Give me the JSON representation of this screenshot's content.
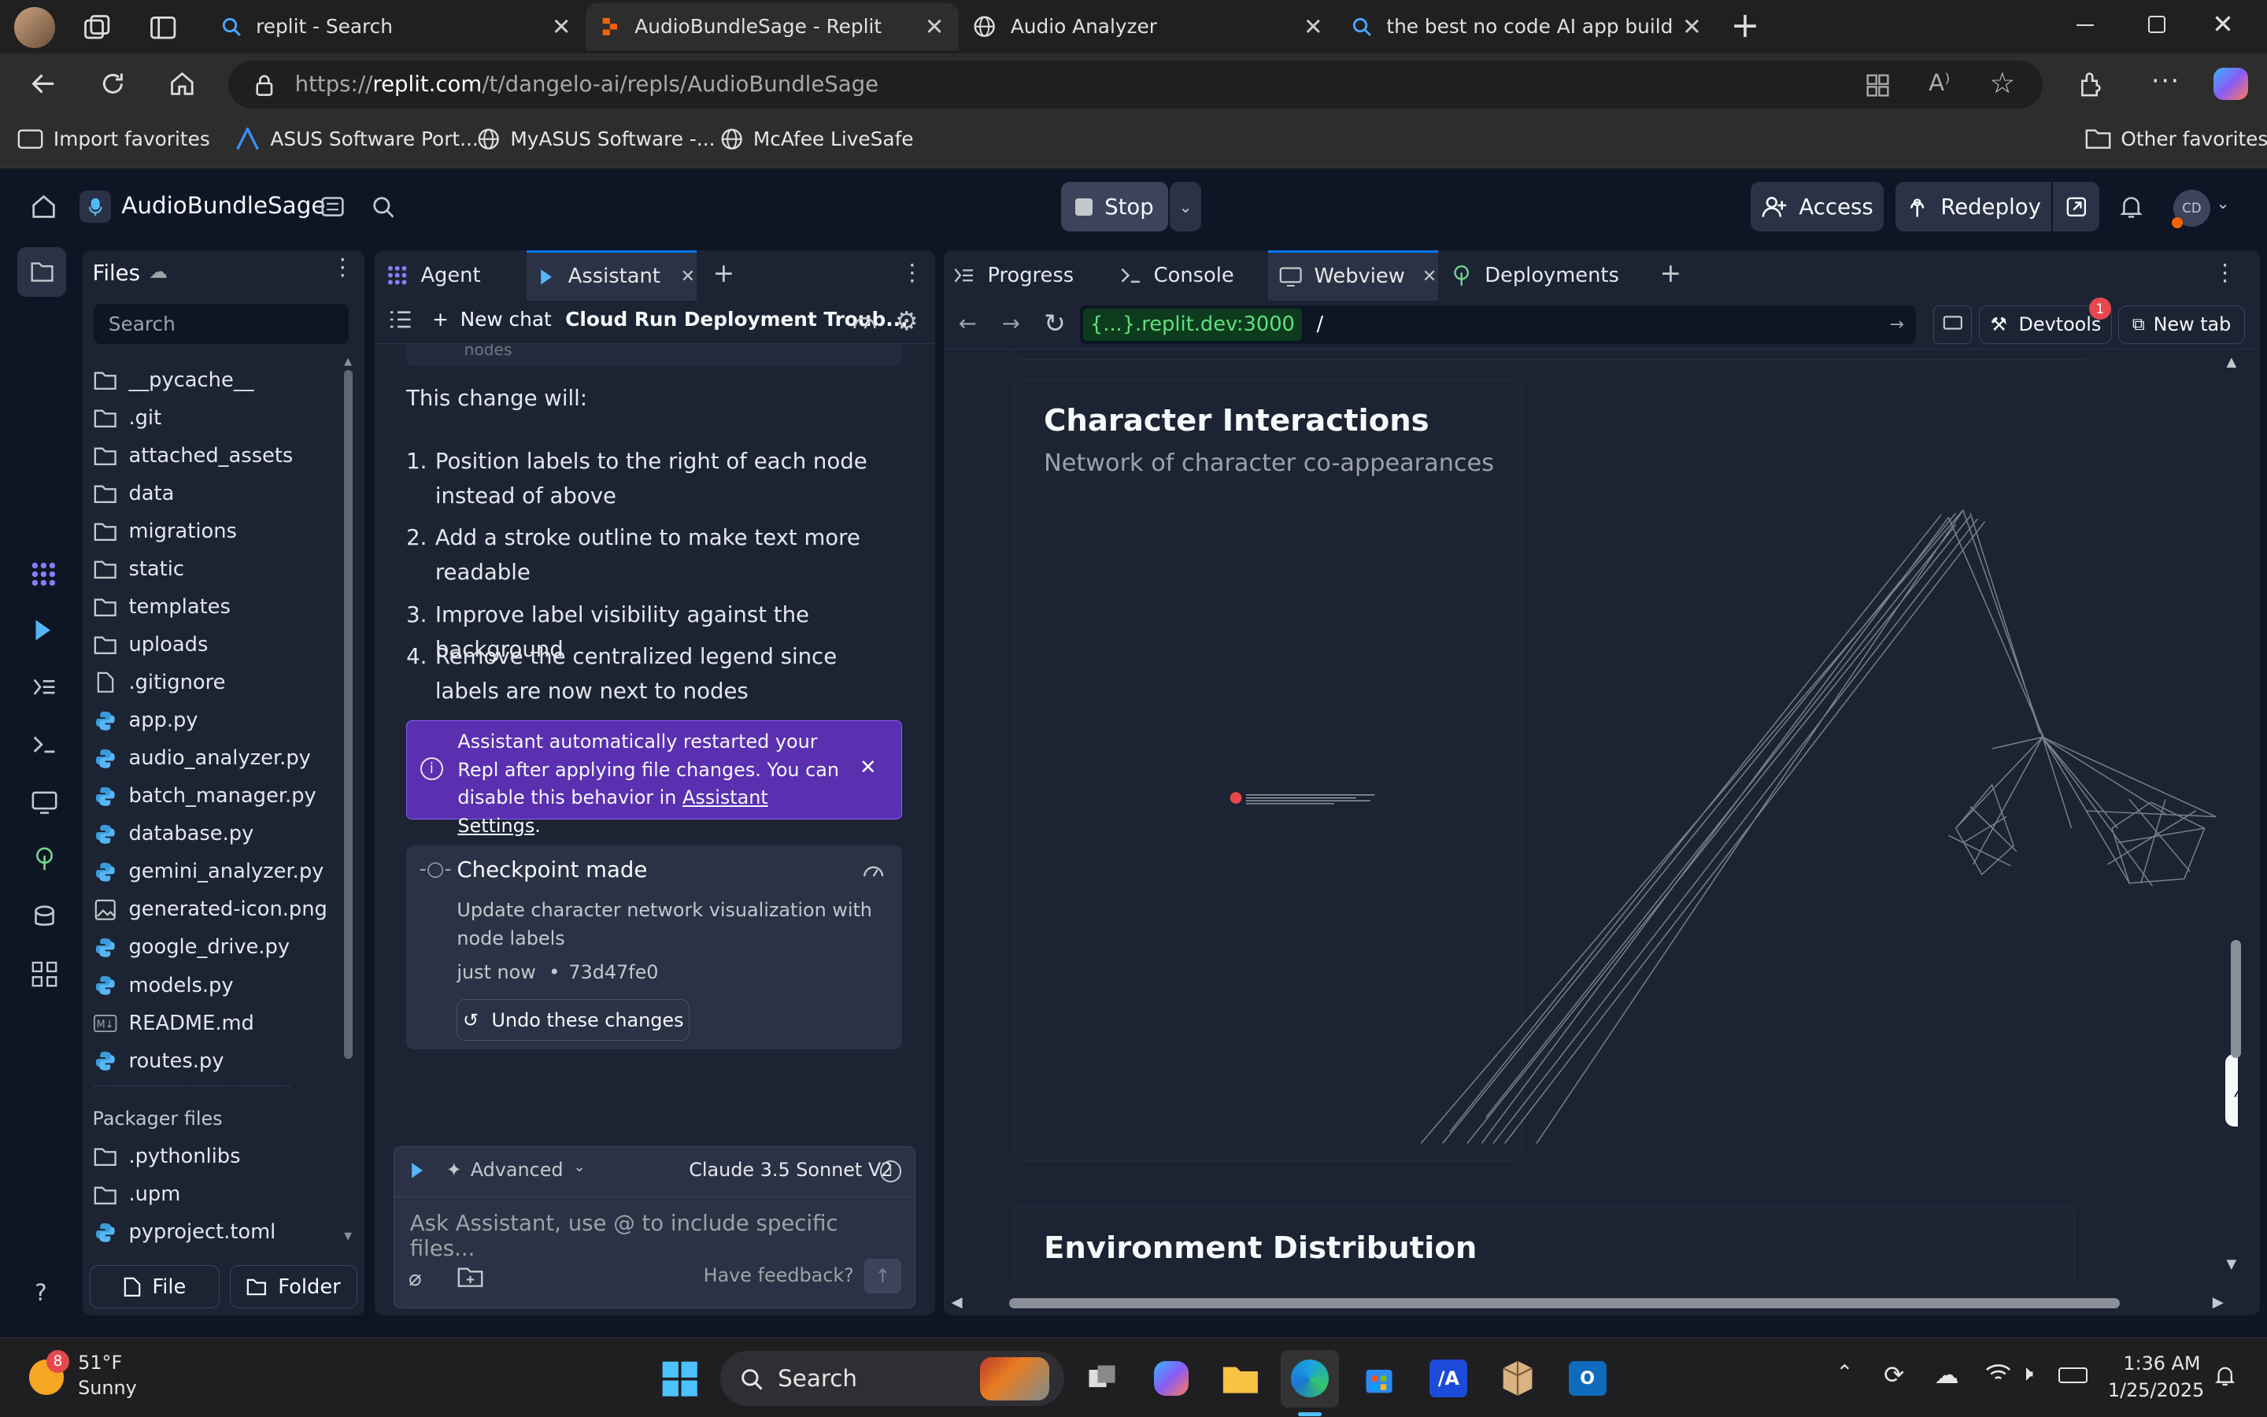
{
  "browser": {
    "tabs": [
      {
        "title": "replit - Search",
        "icon": "search-icon"
      },
      {
        "title": "AudioBundleSage - Replit",
        "icon": "replit-icon",
        "active": true
      },
      {
        "title": "Audio Analyzer",
        "icon": "globe-icon"
      },
      {
        "title": "the best no code AI app builder -",
        "icon": "search-icon"
      }
    ],
    "url_prefix": "https://",
    "url_host": "replit.com",
    "url_path": "/t/dangelo-ai/repls/AudioBundleSage",
    "favorites": [
      {
        "label": "Import favorites",
        "icon": "import-icon"
      },
      {
        "label": "ASUS Software Port...",
        "icon": "asus-icon"
      },
      {
        "label": "MyASUS Software -...",
        "icon": "globe-icon"
      },
      {
        "label": "McAfee LiveSafe",
        "icon": "globe-icon"
      }
    ],
    "other_favorites": "Other favorites"
  },
  "replit": {
    "project_name": "AudioBundleSage",
    "stop_label": "Stop",
    "access_label": "Access",
    "redeploy_label": "Redeploy",
    "avatar_initials": "CD",
    "files": {
      "title": "Files",
      "search_placeholder": "Search",
      "items": [
        {
          "name": "__pycache__",
          "type": "folder"
        },
        {
          "name": ".git",
          "type": "folder"
        },
        {
          "name": "attached_assets",
          "type": "folder"
        },
        {
          "name": "data",
          "type": "folder"
        },
        {
          "name": "migrations",
          "type": "folder"
        },
        {
          "name": "static",
          "type": "folder"
        },
        {
          "name": "templates",
          "type": "folder"
        },
        {
          "name": "uploads",
          "type": "folder"
        },
        {
          "name": ".gitignore",
          "type": "file"
        },
        {
          "name": "app.py",
          "type": "python"
        },
        {
          "name": "audio_analyzer.py",
          "type": "python"
        },
        {
          "name": "batch_manager.py",
          "type": "python"
        },
        {
          "name": "database.py",
          "type": "python"
        },
        {
          "name": "gemini_analyzer.py",
          "type": "python"
        },
        {
          "name": "generated-icon.png",
          "type": "image"
        },
        {
          "name": "google_drive.py",
          "type": "python"
        },
        {
          "name": "models.py",
          "type": "python"
        },
        {
          "name": "README.md",
          "type": "markdown"
        },
        {
          "name": "routes.py",
          "type": "python"
        }
      ],
      "packager_title": "Packager files",
      "packager_items": [
        {
          "name": ".pythonlibs",
          "type": "folder"
        },
        {
          "name": ".upm",
          "type": "folder"
        },
        {
          "name": "pyproject.toml",
          "type": "python"
        }
      ],
      "new_file": "File",
      "new_folder": "Folder"
    },
    "chat": {
      "tabs": [
        "Agent",
        "Assistant"
      ],
      "new_chat": "New chat",
      "chat_title": "Cloud Run Deployment Troub...",
      "cut_text": "nodes",
      "intro": "This change will:",
      "list": [
        {
          "n": "1.",
          "text": "Position labels to the right of each node instead of above"
        },
        {
          "n": "2.",
          "text": "Add a stroke outline to make text more readable"
        },
        {
          "n": "3.",
          "text": "Improve label visibility against the background"
        },
        {
          "n": "4.",
          "text": "Remove the centralized legend since labels are now next to nodes"
        }
      ],
      "notice_text": "Assistant automatically restarted your Repl after applying file changes. You can disable this behavior in ",
      "notice_link": "Assistant Settings",
      "notice_end": ".",
      "checkpoint_title": "Checkpoint made",
      "checkpoint_desc": "Update character network visualization with node labels",
      "checkpoint_time": "just now",
      "checkpoint_hash": "73d47fe0",
      "undo_label": "Undo these changes",
      "mode_label": "Advanced",
      "model_label": "Claude 3.5 Sonnet V2",
      "input_placeholder": "Ask Assistant, use @ to include specific files...",
      "feedback_label": "Have feedback?"
    },
    "webview": {
      "tabs": [
        "Progress",
        "Console",
        "Webview",
        "Deployments"
      ],
      "url_host": "{...}.replit.dev:3000",
      "url_path": "/",
      "devtools_label": "Devtools",
      "devtools_badge": "1",
      "new_tab_label": "New tab",
      "card_title": "Character Interactions",
      "card_subtitle": "Network of character co-appearances",
      "next_title": "Environment Distribution"
    }
  },
  "taskbar": {
    "weather_temp": "51°F",
    "weather_desc": "Sunny",
    "weather_badge": "8",
    "search_label": "Search",
    "time": "1:36 AM",
    "date": "1/25/2025"
  }
}
